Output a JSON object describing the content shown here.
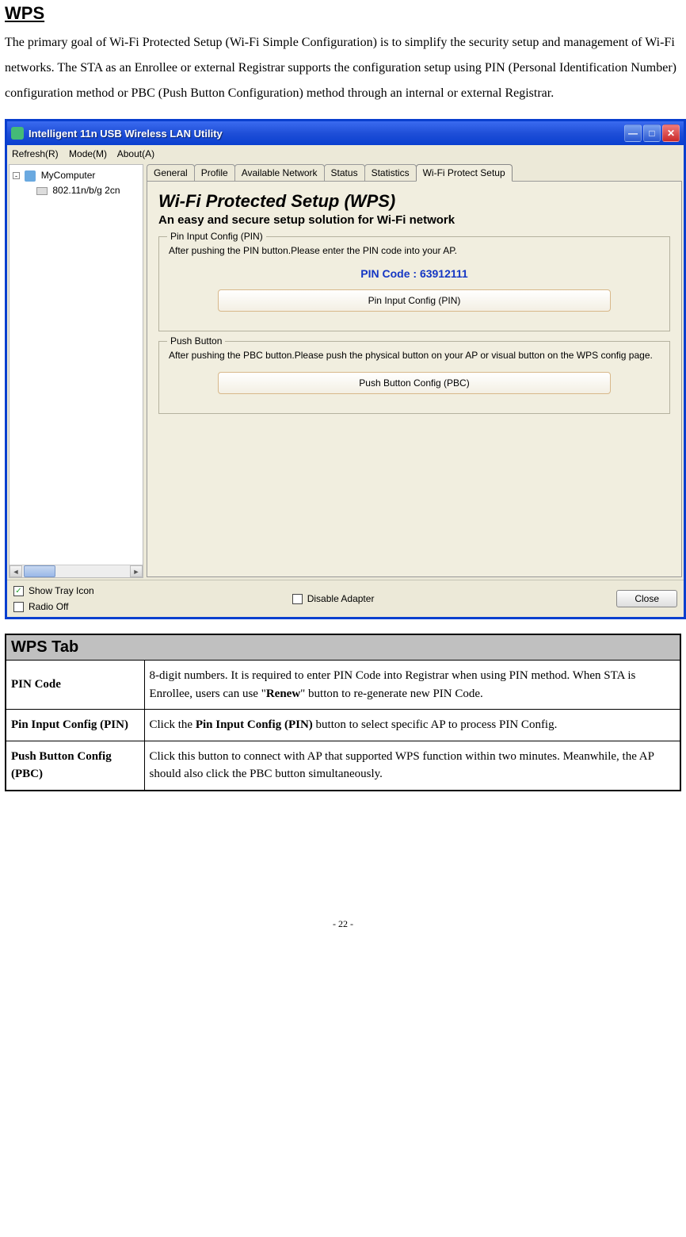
{
  "section_title": "WPS",
  "intro": "The primary goal of Wi-Fi Protected Setup (Wi-Fi Simple Configuration) is to simplify the security setup and management of Wi-Fi networks. The STA as an Enrollee or external Registrar supports the configuration setup using PIN (Personal Identification Number) configuration method or PBC (Push Button Configuration) method through an internal or external Registrar.",
  "window": {
    "title": "Intelligent 11n USB Wireless LAN Utility",
    "menus": {
      "refresh": "Refresh(R)",
      "mode": "Mode(M)",
      "about": "About(A)"
    },
    "tree": {
      "root": "MyComputer",
      "child": "802.11n/b/g 2cn"
    },
    "tabs": [
      "General",
      "Profile",
      "Available Network",
      "Status",
      "Statistics",
      "Wi-Fi Protect Setup"
    ],
    "wps": {
      "title": "Wi-Fi Protected Setup (WPS)",
      "subtitle": "An easy and secure setup solution for Wi-Fi network",
      "pin_legend": "Pin Input Config (PIN)",
      "pin_desc": "After pushing the PIN button.Please enter the PIN code into your AP.",
      "pin_label": "PIN Code :",
      "pin_value": "63912111",
      "pin_button": "Pin Input Config (PIN)",
      "pbc_legend": "Push Button",
      "pbc_desc": "After pushing the PBC button.Please push the physical button on your AP or visual button on the WPS config page.",
      "pbc_button": "Push Button Config (PBC)"
    },
    "bottom": {
      "show_tray": "Show Tray Icon",
      "radio_off": "Radio Off",
      "disable_adapter": "Disable Adapter",
      "close": "Close"
    }
  },
  "table": {
    "header": "WPS Tab",
    "rows": [
      {
        "label": "PIN Code",
        "pre": "8-digit numbers. It is required to enter PIN Code into Registrar when using PIN method. When STA is Enrollee, users can use \"",
        "bold": "Renew",
        "post": "\" button to re-generate new PIN Code."
      },
      {
        "label": "Pin Input Config (PIN)",
        "pre": "Click the ",
        "bold": "Pin Input Config (PIN)",
        "post": " button to select specific AP to process PIN Config."
      },
      {
        "label": "Push Button Config (PBC)",
        "pre": "Click this button to connect with AP that supported WPS function within two minutes. Meanwhile, the AP should also click the PBC button simultaneously.",
        "bold": "",
        "post": ""
      }
    ]
  },
  "page_number": "- 22 -"
}
